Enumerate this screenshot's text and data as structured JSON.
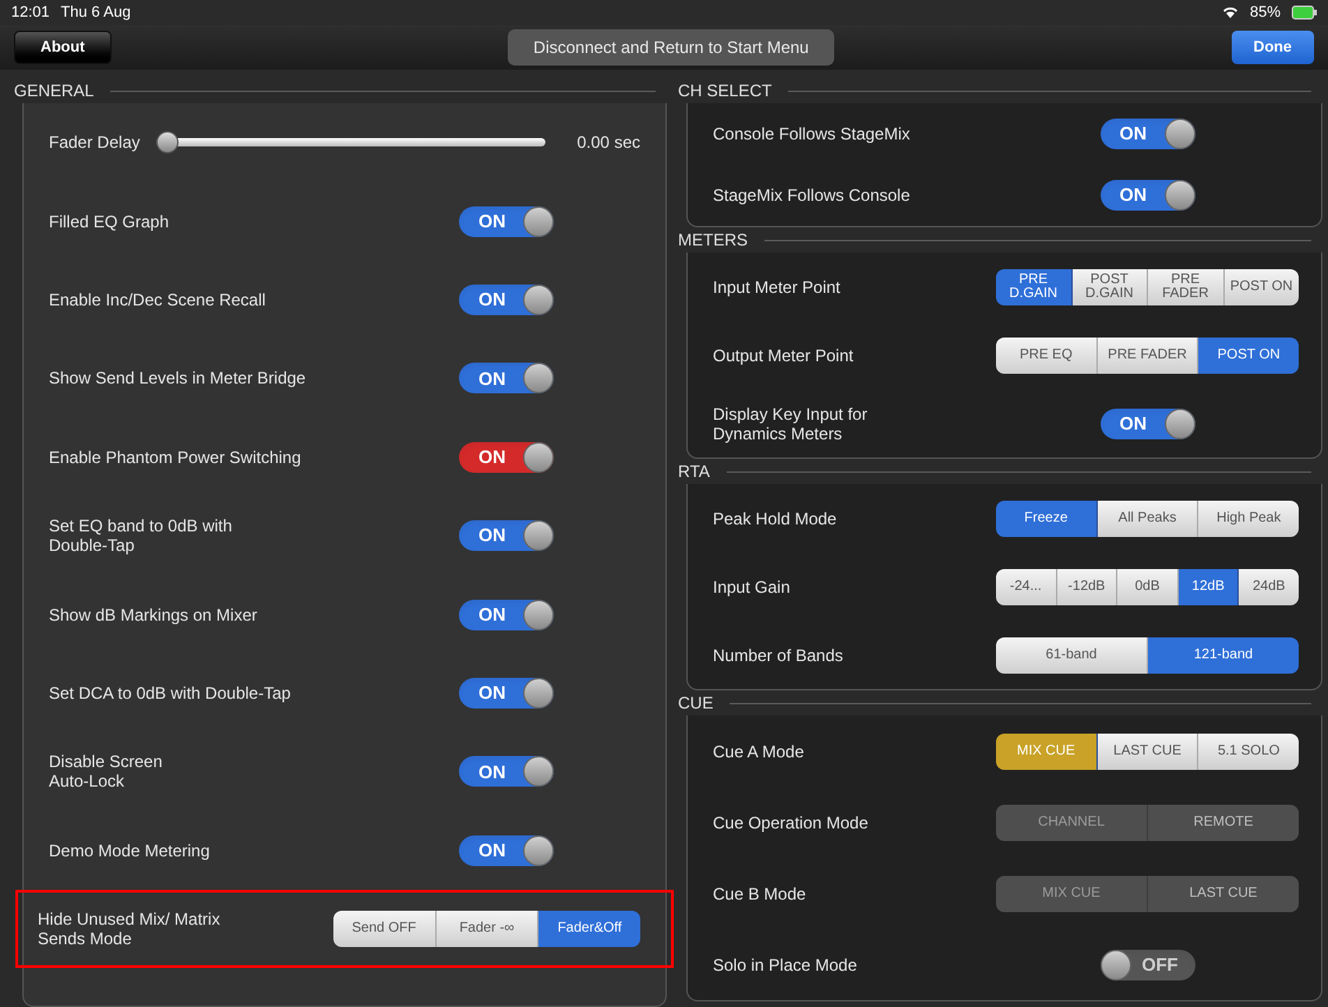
{
  "status_bar": {
    "time": "12:01",
    "date": "Thu 6 Aug",
    "battery": "85%"
  },
  "toolbar": {
    "left_button": "About",
    "center_button": "Disconnect and Return to Start Menu",
    "right_button": "Done"
  },
  "columns": [
    {
      "sections": [
        {
          "title": "GENERAL",
          "rows": [
            {
              "kind": "slider",
              "label": "Fader Delay",
              "level": 0,
              "reading": "0.00 sec"
            },
            {
              "kind": "toggle",
              "label": "Filled EQ Graph",
              "on": true,
              "text": "ON",
              "color": "#2f6fd8"
            },
            {
              "kind": "toggle",
              "label": "Enable Inc/Dec Scene Recall",
              "on": true,
              "text": "ON",
              "color": "#2f6fd8"
            },
            {
              "kind": "toggle",
              "label": "Show Send Levels in Meter Bridge",
              "on": true,
              "text": "ON",
              "color": "#2f6fd8"
            },
            {
              "kind": "toggle",
              "label": "Enable Phantom Power Switching",
              "on": true,
              "text": "ON",
              "color": "#d42a2a"
            },
            {
              "kind": "toggle",
              "label": "Set EQ band to 0dB with\nDouble-Tap",
              "on": true,
              "text": "ON",
              "color": "#2f6fd8"
            },
            {
              "kind": "toggle",
              "label": "Show dB Markings on Mixer",
              "on": true,
              "text": "ON",
              "color": "#2f6fd8"
            },
            {
              "kind": "toggle",
              "label": "Set DCA to 0dB with Double-Tap",
              "on": true,
              "text": "ON",
              "color": "#2f6fd8"
            },
            {
              "kind": "toggle",
              "label": "Disable Screen\nAuto-Lock",
              "on": true,
              "text": "ON",
              "color": "#2f6fd8"
            },
            {
              "kind": "toggle",
              "label": "Demo Mode Metering",
              "on": true,
              "text": "ON",
              "color": "#2f6fd8"
            },
            {
              "kind": "segmented",
              "label": "Hide Unused Mix/ Matrix\nSends Mode",
              "highlighted": true,
              "disabled": false,
              "color": "#2f6fd8",
              "options": [
                {
                  "label": "Send OFF",
                  "selected": false
                },
                {
                  "label": "Fader -∞",
                  "selected": false
                },
                {
                  "label": "Fader&Off",
                  "selected": true
                }
              ]
            }
          ]
        }
      ]
    },
    {
      "sections": [
        {
          "title": "CH SELECT",
          "rows": [
            {
              "kind": "toggle",
              "label": "Console Follows StageMix",
              "on": true,
              "text": "ON",
              "color": "#2f6fd8"
            },
            {
              "kind": "toggle",
              "label": "StageMix Follows Console",
              "on": true,
              "text": "ON",
              "color": "#2f6fd8"
            }
          ]
        },
        {
          "title": "METERS",
          "rows": [
            {
              "kind": "segmented",
              "label": "Input Meter Point",
              "disabled": false,
              "color": "#2f6fd8",
              "options": [
                {
                  "label": "PRE D.GAIN",
                  "selected": true
                },
                {
                  "label": "POST D.GAIN",
                  "selected": false
                },
                {
                  "label": "PRE FADER",
                  "selected": false
                },
                {
                  "label": "POST ON",
                  "selected": false
                }
              ]
            },
            {
              "kind": "segmented",
              "label": "Output Meter Point",
              "disabled": false,
              "color": "#2f6fd8",
              "options": [
                {
                  "label": "PRE EQ",
                  "selected": false
                },
                {
                  "label": "PRE FADER",
                  "selected": false
                },
                {
                  "label": "POST ON",
                  "selected": true
                }
              ]
            },
            {
              "kind": "toggle",
              "label": "Display Key Input for\nDynamics Meters",
              "on": true,
              "text": "ON",
              "color": "#2f6fd8"
            }
          ]
        },
        {
          "title": "RTA",
          "rows": [
            {
              "kind": "segmented",
              "label": "Peak Hold Mode",
              "disabled": false,
              "color": "#2f6fd8",
              "options": [
                {
                  "label": "Freeze",
                  "selected": true
                },
                {
                  "label": "All Peaks",
                  "selected": false
                },
                {
                  "label": "High Peak",
                  "selected": false
                }
              ]
            },
            {
              "kind": "segmented",
              "label": "Input Gain",
              "disabled": false,
              "color": "#2f6fd8",
              "options": [
                {
                  "label": "-24...",
                  "selected": false
                },
                {
                  "label": "-12dB",
                  "selected": false
                },
                {
                  "label": "0dB",
                  "selected": false
                },
                {
                  "label": "12dB",
                  "selected": true
                },
                {
                  "label": "24dB",
                  "selected": false
                }
              ]
            },
            {
              "kind": "segmented",
              "label": "Number of Bands",
              "disabled": false,
              "color": "#2f6fd8",
              "options": [
                {
                  "label": "61-band",
                  "selected": false
                },
                {
                  "label": "121-band",
                  "selected": true
                }
              ]
            }
          ]
        },
        {
          "title": "CUE",
          "rows": [
            {
              "kind": "segmented",
              "label": "Cue A Mode",
              "disabled": false,
              "color": "#c9a227",
              "options": [
                {
                  "label": "MIX CUE",
                  "selected": true
                },
                {
                  "label": "LAST CUE",
                  "selected": false
                },
                {
                  "label": "5.1 SOLO",
                  "selected": false
                }
              ]
            },
            {
              "kind": "segmented",
              "label": "Cue Operation Mode",
              "disabled": true,
              "options": [
                {
                  "label": "CHANNEL",
                  "selected": true
                },
                {
                  "label": "REMOTE",
                  "selected": false
                }
              ]
            },
            {
              "kind": "segmented",
              "label": "Cue B Mode",
              "disabled": true,
              "options": [
                {
                  "label": "MIX CUE",
                  "selected": true
                },
                {
                  "label": "LAST CUE",
                  "selected": false
                }
              ]
            },
            {
              "kind": "toggle",
              "label": "Solo in Place Mode",
              "on": false,
              "text": "OFF"
            }
          ]
        }
      ]
    }
  ]
}
